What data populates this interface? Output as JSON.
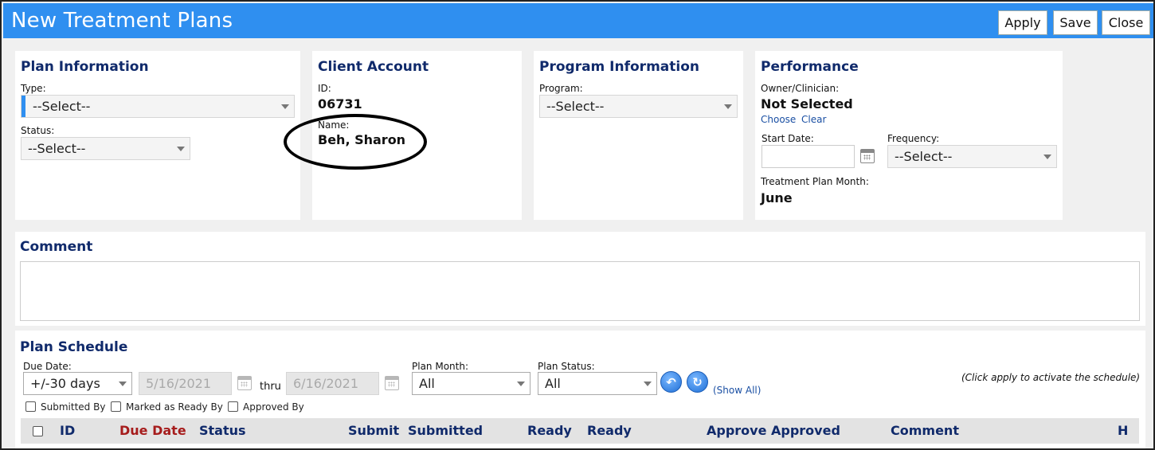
{
  "window": {
    "title": "New Treatment Plans",
    "buttons": {
      "apply": "Apply",
      "save": "Save",
      "close": "Close"
    }
  },
  "plan_information": {
    "heading": "Plan Information",
    "type_label": "Type:",
    "type_value": "--Select--",
    "status_label": "Status:",
    "status_value": "--Select--"
  },
  "client_account": {
    "heading": "Client Account",
    "id_label": "ID:",
    "id_value": "06731",
    "name_label": "Name:",
    "name_value": "Beh, Sharon"
  },
  "program_information": {
    "heading": "Program Information",
    "program_label": "Program:",
    "program_value": "--Select--"
  },
  "performance": {
    "heading": "Performance",
    "owner_label": "Owner/Clinician:",
    "owner_value": "Not Selected",
    "choose_link": "Choose",
    "clear_link": "Clear",
    "start_date_label": "Start Date:",
    "start_date_value": "",
    "frequency_label": "Frequency:",
    "frequency_value": "--Select--",
    "month_label": "Treatment Plan Month:",
    "month_value": "June"
  },
  "comment": {
    "heading": "Comment",
    "value": ""
  },
  "plan_schedule": {
    "heading": "Plan Schedule",
    "due_date_label": "Due Date:",
    "due_range_value": "+/-30 days",
    "from_date": "5/16/2021",
    "thru_label": "thru",
    "to_date": "6/16/2021",
    "plan_month_label": "Plan Month:",
    "plan_month_value": "All",
    "plan_status_label": "Plan Status:",
    "plan_status_value": "All",
    "show_all_link": "(Show All)",
    "hint": "(Click apply to activate the schedule)",
    "filters": {
      "submitted_by": "Submitted By",
      "marked_ready_by": "Marked as Ready By",
      "approved_by": "Approved By"
    },
    "columns": {
      "id": "ID",
      "due_date": "Due Date",
      "status": "Status",
      "submit": "Submit",
      "submitted": "Submitted",
      "ready": "Ready",
      "ready2": "Ready",
      "approve": "Approve",
      "approved": "Approved",
      "comment": "Comment",
      "h": "H"
    }
  },
  "colors": {
    "titlebar": "#2f8ff0",
    "heading_text": "#102a6b",
    "due_date_header": "#a61c1c",
    "link": "#1a4fa3"
  }
}
